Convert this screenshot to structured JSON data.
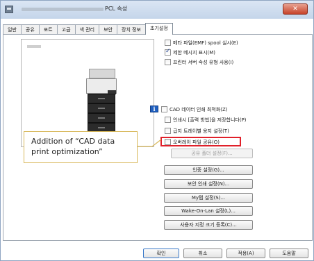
{
  "window": {
    "title": "PCL 속성",
    "close_label": "✕"
  },
  "tabs": [
    {
      "label": "일반"
    },
    {
      "label": "공유"
    },
    {
      "label": "포트"
    },
    {
      "label": "고급"
    },
    {
      "label": "색 관리"
    },
    {
      "label": "보안"
    },
    {
      "label": "장치 정보"
    },
    {
      "label": "초기설정"
    }
  ],
  "active_tab": "초기설정",
  "options": [
    {
      "label": "메타 파일(EMF) spool 실시(E)",
      "checked": false
    },
    {
      "label": "제한 메시지 표시(M)",
      "checked": true
    },
    {
      "label": "프린터 서버 속성 유형 사용(I)",
      "checked": false
    },
    {
      "label": "CAD 데이터 인쇄 최적화(Z)",
      "checked": false
    },
    {
      "label": "인쇄시 [출력 방법]을 저장합니다(P)",
      "checked": false
    },
    {
      "label": "급지 트레이별 용지 설정(T)",
      "checked": false
    },
    {
      "label": "오버레이 파일 공유(O)",
      "checked": false
    }
  ],
  "buttons": {
    "shared_folder": "공유 폴더 설정(F)...",
    "auth": "인증 설정(G)...",
    "secure_print": "보안 인쇄 설정(N)...",
    "myab": "My탭 설정(S)...",
    "wol": "Wake-On-Lan 설정(L)...",
    "custom_size": "사용자 지정 크기 등록(C)..."
  },
  "footer": {
    "ok": "확인",
    "cancel": "취소",
    "apply": "적용(A)",
    "help": "도움말"
  },
  "callout": {
    "text": "Addition of “CAD data print optimization”"
  },
  "colors": {
    "highlight": "#e0202a",
    "callout_border": "#d8b85a"
  }
}
